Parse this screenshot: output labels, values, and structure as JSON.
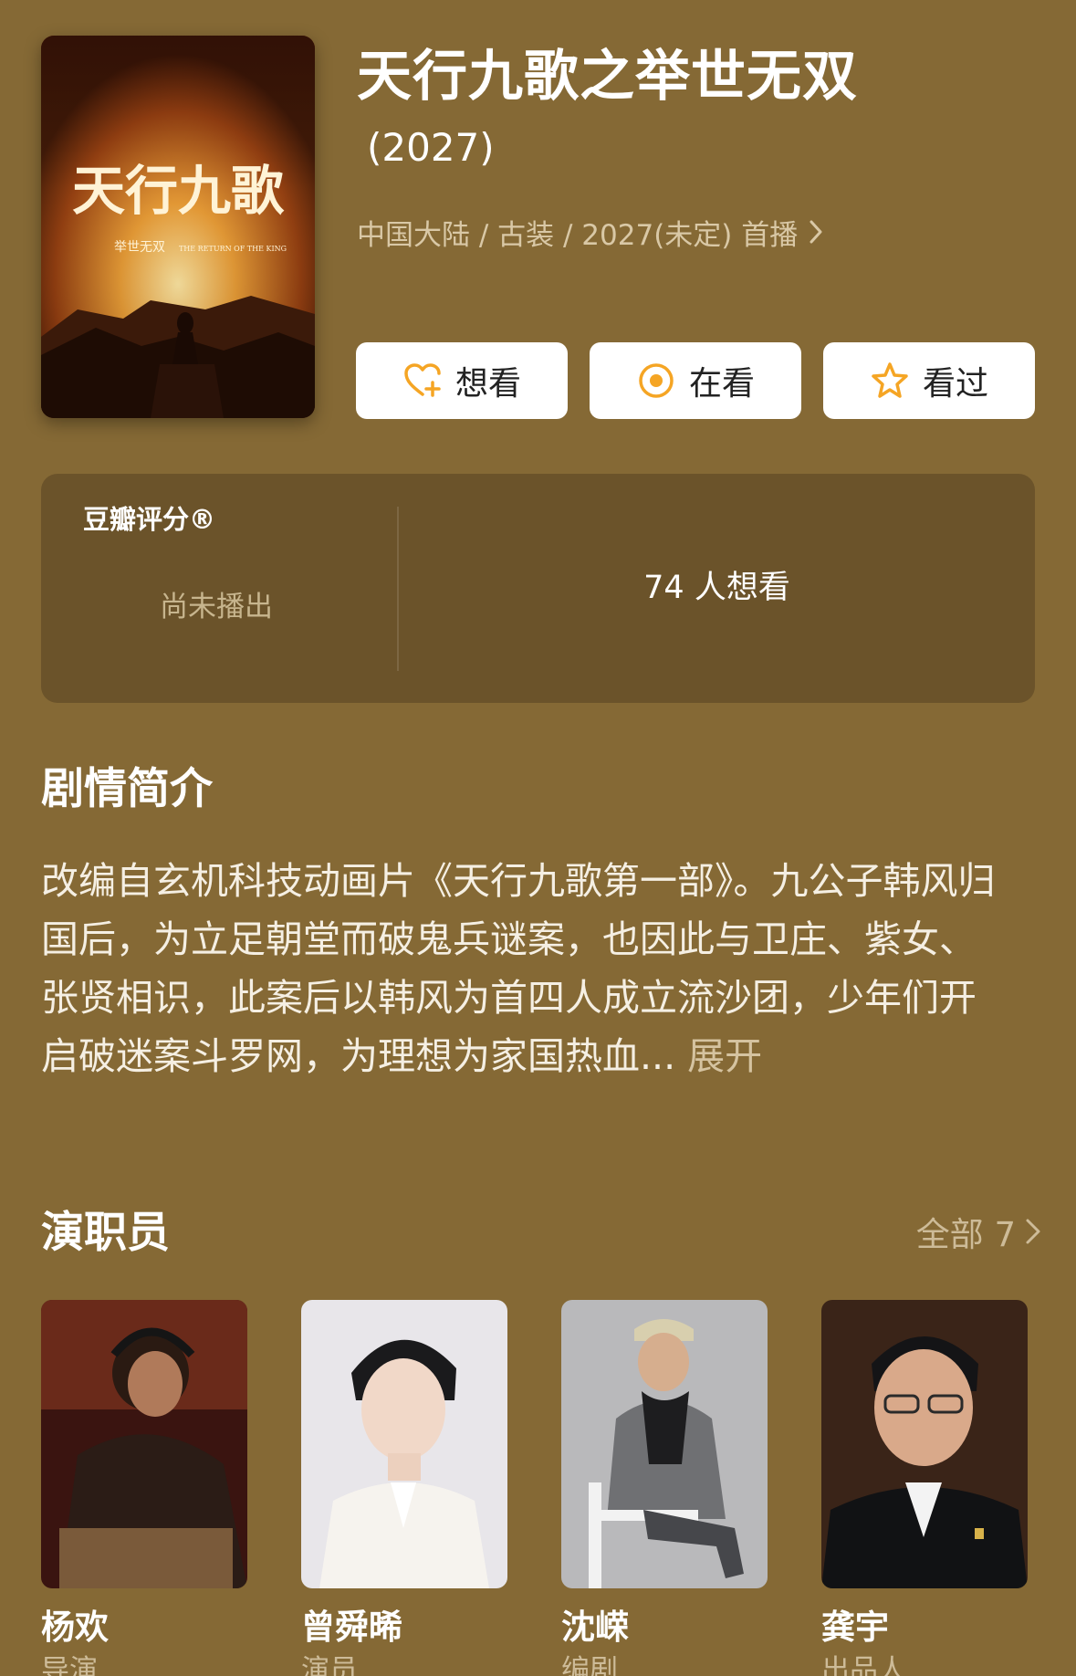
{
  "show": {
    "title": "天行九歌之举世无双",
    "year": "(2027)",
    "meta": "中国大陆 / 古装 / 2027(未定) 首播",
    "poster_text": "天行九歌",
    "poster_subtitle": "举世无双",
    "poster_en": "THE RETURN OF THE KING"
  },
  "actions": {
    "want": "想看",
    "watching": "在看",
    "watched": "看过"
  },
  "rating": {
    "label": "豆瓣评分®",
    "status": "尚未播出",
    "want_count": "74 人想看"
  },
  "synopsis": {
    "heading": "剧情简介",
    "text": "改编自玄机科技动画片《天行九歌第一部》。九公子韩风归国后，为立足朝堂而破鬼兵谜案，也因此与卫庄、紫女、张贤相识，此案后以韩风为首四人成立流沙团，少年们开启破迷案斗罗网，为理想为家国热血...",
    "expand": "展开"
  },
  "cast": {
    "heading": "演职员",
    "all_label": "全部 7",
    "members": [
      {
        "name": "杨欢",
        "role": "导演"
      },
      {
        "name": "曾舜晞",
        "role": "演员"
      },
      {
        "name": "沈嵘",
        "role": "编剧"
      },
      {
        "name": "龚宇",
        "role": "出品人"
      }
    ]
  },
  "colors": {
    "background": "#856935",
    "card": "#6b532a",
    "accent": "#f5a524"
  },
  "icons": [
    "heart-plus-icon",
    "target-dot-icon",
    "star-outline-icon",
    "chevron-right-icon"
  ]
}
